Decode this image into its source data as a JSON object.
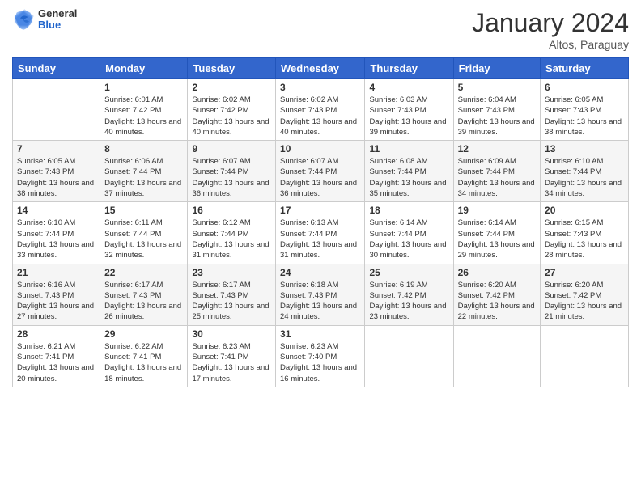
{
  "logo": {
    "general": "General",
    "blue": "Blue"
  },
  "title": "January 2024",
  "location": "Altos, Paraguay",
  "days_header": [
    "Sunday",
    "Monday",
    "Tuesday",
    "Wednesday",
    "Thursday",
    "Friday",
    "Saturday"
  ],
  "weeks": [
    [
      {
        "num": "",
        "sunrise": "",
        "sunset": "",
        "daylight": ""
      },
      {
        "num": "1",
        "sunrise": "Sunrise: 6:01 AM",
        "sunset": "Sunset: 7:42 PM",
        "daylight": "Daylight: 13 hours and 40 minutes."
      },
      {
        "num": "2",
        "sunrise": "Sunrise: 6:02 AM",
        "sunset": "Sunset: 7:42 PM",
        "daylight": "Daylight: 13 hours and 40 minutes."
      },
      {
        "num": "3",
        "sunrise": "Sunrise: 6:02 AM",
        "sunset": "Sunset: 7:43 PM",
        "daylight": "Daylight: 13 hours and 40 minutes."
      },
      {
        "num": "4",
        "sunrise": "Sunrise: 6:03 AM",
        "sunset": "Sunset: 7:43 PM",
        "daylight": "Daylight: 13 hours and 39 minutes."
      },
      {
        "num": "5",
        "sunrise": "Sunrise: 6:04 AM",
        "sunset": "Sunset: 7:43 PM",
        "daylight": "Daylight: 13 hours and 39 minutes."
      },
      {
        "num": "6",
        "sunrise": "Sunrise: 6:05 AM",
        "sunset": "Sunset: 7:43 PM",
        "daylight": "Daylight: 13 hours and 38 minutes."
      }
    ],
    [
      {
        "num": "7",
        "sunrise": "Sunrise: 6:05 AM",
        "sunset": "Sunset: 7:43 PM",
        "daylight": "Daylight: 13 hours and 38 minutes."
      },
      {
        "num": "8",
        "sunrise": "Sunrise: 6:06 AM",
        "sunset": "Sunset: 7:44 PM",
        "daylight": "Daylight: 13 hours and 37 minutes."
      },
      {
        "num": "9",
        "sunrise": "Sunrise: 6:07 AM",
        "sunset": "Sunset: 7:44 PM",
        "daylight": "Daylight: 13 hours and 36 minutes."
      },
      {
        "num": "10",
        "sunrise": "Sunrise: 6:07 AM",
        "sunset": "Sunset: 7:44 PM",
        "daylight": "Daylight: 13 hours and 36 minutes."
      },
      {
        "num": "11",
        "sunrise": "Sunrise: 6:08 AM",
        "sunset": "Sunset: 7:44 PM",
        "daylight": "Daylight: 13 hours and 35 minutes."
      },
      {
        "num": "12",
        "sunrise": "Sunrise: 6:09 AM",
        "sunset": "Sunset: 7:44 PM",
        "daylight": "Daylight: 13 hours and 34 minutes."
      },
      {
        "num": "13",
        "sunrise": "Sunrise: 6:10 AM",
        "sunset": "Sunset: 7:44 PM",
        "daylight": "Daylight: 13 hours and 34 minutes."
      }
    ],
    [
      {
        "num": "14",
        "sunrise": "Sunrise: 6:10 AM",
        "sunset": "Sunset: 7:44 PM",
        "daylight": "Daylight: 13 hours and 33 minutes."
      },
      {
        "num": "15",
        "sunrise": "Sunrise: 6:11 AM",
        "sunset": "Sunset: 7:44 PM",
        "daylight": "Daylight: 13 hours and 32 minutes."
      },
      {
        "num": "16",
        "sunrise": "Sunrise: 6:12 AM",
        "sunset": "Sunset: 7:44 PM",
        "daylight": "Daylight: 13 hours and 31 minutes."
      },
      {
        "num": "17",
        "sunrise": "Sunrise: 6:13 AM",
        "sunset": "Sunset: 7:44 PM",
        "daylight": "Daylight: 13 hours and 31 minutes."
      },
      {
        "num": "18",
        "sunrise": "Sunrise: 6:14 AM",
        "sunset": "Sunset: 7:44 PM",
        "daylight": "Daylight: 13 hours and 30 minutes."
      },
      {
        "num": "19",
        "sunrise": "Sunrise: 6:14 AM",
        "sunset": "Sunset: 7:44 PM",
        "daylight": "Daylight: 13 hours and 29 minutes."
      },
      {
        "num": "20",
        "sunrise": "Sunrise: 6:15 AM",
        "sunset": "Sunset: 7:43 PM",
        "daylight": "Daylight: 13 hours and 28 minutes."
      }
    ],
    [
      {
        "num": "21",
        "sunrise": "Sunrise: 6:16 AM",
        "sunset": "Sunset: 7:43 PM",
        "daylight": "Daylight: 13 hours and 27 minutes."
      },
      {
        "num": "22",
        "sunrise": "Sunrise: 6:17 AM",
        "sunset": "Sunset: 7:43 PM",
        "daylight": "Daylight: 13 hours and 26 minutes."
      },
      {
        "num": "23",
        "sunrise": "Sunrise: 6:17 AM",
        "sunset": "Sunset: 7:43 PM",
        "daylight": "Daylight: 13 hours and 25 minutes."
      },
      {
        "num": "24",
        "sunrise": "Sunrise: 6:18 AM",
        "sunset": "Sunset: 7:43 PM",
        "daylight": "Daylight: 13 hours and 24 minutes."
      },
      {
        "num": "25",
        "sunrise": "Sunrise: 6:19 AM",
        "sunset": "Sunset: 7:42 PM",
        "daylight": "Daylight: 13 hours and 23 minutes."
      },
      {
        "num": "26",
        "sunrise": "Sunrise: 6:20 AM",
        "sunset": "Sunset: 7:42 PM",
        "daylight": "Daylight: 13 hours and 22 minutes."
      },
      {
        "num": "27",
        "sunrise": "Sunrise: 6:20 AM",
        "sunset": "Sunset: 7:42 PM",
        "daylight": "Daylight: 13 hours and 21 minutes."
      }
    ],
    [
      {
        "num": "28",
        "sunrise": "Sunrise: 6:21 AM",
        "sunset": "Sunset: 7:41 PM",
        "daylight": "Daylight: 13 hours and 20 minutes."
      },
      {
        "num": "29",
        "sunrise": "Sunrise: 6:22 AM",
        "sunset": "Sunset: 7:41 PM",
        "daylight": "Daylight: 13 hours and 18 minutes."
      },
      {
        "num": "30",
        "sunrise": "Sunrise: 6:23 AM",
        "sunset": "Sunset: 7:41 PM",
        "daylight": "Daylight: 13 hours and 17 minutes."
      },
      {
        "num": "31",
        "sunrise": "Sunrise: 6:23 AM",
        "sunset": "Sunset: 7:40 PM",
        "daylight": "Daylight: 13 hours and 16 minutes."
      },
      {
        "num": "",
        "sunrise": "",
        "sunset": "",
        "daylight": ""
      },
      {
        "num": "",
        "sunrise": "",
        "sunset": "",
        "daylight": ""
      },
      {
        "num": "",
        "sunrise": "",
        "sunset": "",
        "daylight": ""
      }
    ]
  ]
}
